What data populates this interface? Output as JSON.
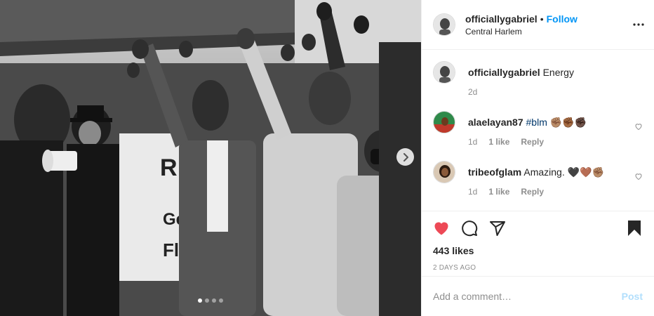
{
  "post": {
    "username": "officiallygabriel",
    "separator": "•",
    "follow_label": "Follow",
    "location": "Central Harlem",
    "photo_dots": 4,
    "photo_active_dot": 0
  },
  "caption": {
    "username": "officiallygabriel",
    "text": "Energy",
    "time": "2d"
  },
  "comments": [
    {
      "username": "alaelayan87",
      "hashtag": "#blm",
      "emoji": "✊🏽✊🏾✊🏿",
      "text": "",
      "time": "1d",
      "likes": "1 like",
      "reply": "Reply"
    },
    {
      "username": "tribeofglam",
      "hashtag": "",
      "text": "Amazing.",
      "emoji": "🖤🤎✊🏽",
      "time": "1d",
      "likes": "1 like",
      "reply": "Reply"
    }
  ],
  "actions": {
    "likes": "443 likes",
    "date": "2 DAYS AGO",
    "liked": true,
    "like_color": "#ed4956"
  },
  "add_comment": {
    "placeholder": "Add a comment…",
    "post_label": "Post"
  },
  "icons": [
    "chevron-right-icon",
    "more-icon",
    "heart-icon",
    "comment-icon",
    "share-icon",
    "bookmark-icon",
    "like-small-icon"
  ]
}
